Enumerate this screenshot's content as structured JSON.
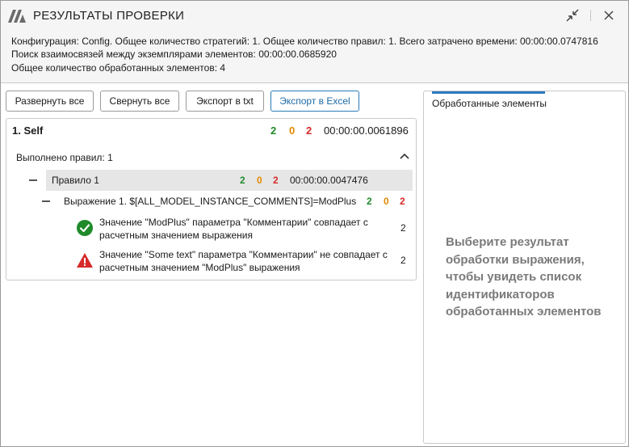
{
  "window": {
    "title": "РЕЗУЛЬТАТЫ ПРОВЕРКИ"
  },
  "info": {
    "line1": "Конфигурация: Config. Общее количество стратегий: 1. Общее количество правил: 1. Всего затрачено времени: 00:00:00.0747816",
    "line2": "Поиск взаимосвязей между экземплярами элементов: 00:00:00.0685920",
    "line3": "Общее количество обработанных элементов: 4"
  },
  "toolbar": {
    "expand_all": "Развернуть все",
    "collapse_all": "Свернуть все",
    "export_txt": "Экспорт в txt",
    "export_excel": "Экспорт в Excel"
  },
  "strategy": {
    "name": "1. Self",
    "ok": "2",
    "warn": "0",
    "err": "2",
    "time": "00:00:00.0061896",
    "rules_done": "Выполнено правил: 1",
    "rule": {
      "name": "Правило 1",
      "ok": "2",
      "warn": "0",
      "err": "2",
      "time": "00:00:00.0047476",
      "expression": {
        "name": "Выражение 1. $[ALL_MODEL_INSTANCE_COMMENTS]=ModPlus",
        "ok": "2",
        "warn": "0",
        "err": "2",
        "results": [
          {
            "status": "success",
            "icon": "check-circle-icon",
            "line1": "Значение \"ModPlus\" параметра \"Комментарии\" совпадает с",
            "line2": "расчетным значением выражения",
            "count": "2"
          },
          {
            "status": "error",
            "icon": "warning-triangle-icon",
            "line1": "Значение \"Some text\" параметра \"Комментарии\" не совпадает с",
            "line2": "расчетным значением \"ModPlus\" выражения",
            "count": "2"
          }
        ]
      }
    }
  },
  "right_panel": {
    "tab_label": "Обработанные элементы",
    "placeholder": "Выберите результат обработки выражения, чтобы увидеть список идентификаторов обработанных элементов"
  },
  "colors": {
    "ok": "#1f8a2a",
    "warn": "#e08a00",
    "err": "#d62a2a",
    "accent": "#2b7bbf"
  }
}
